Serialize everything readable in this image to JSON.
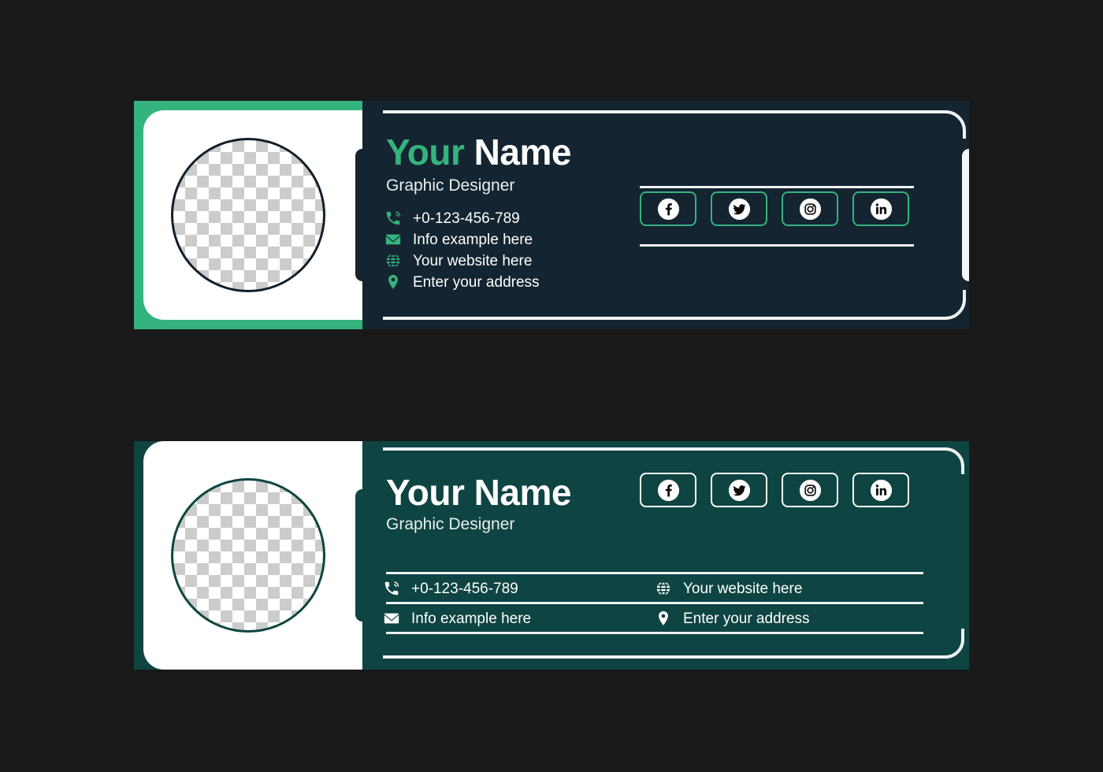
{
  "page": {
    "background_color": "#191919"
  },
  "cards": [
    {
      "id": "card-dark-navy",
      "background_color": "#142430",
      "accent_color": "#35b37e",
      "name_first": "Your",
      "name_last": " Name",
      "role": "Graphic Designer",
      "avatar": "photo-placeholder-checkerboard",
      "contacts": [
        {
          "icon": "phone-icon",
          "text": "+0-123-456-789"
        },
        {
          "icon": "envelope-icon",
          "text": "Info example here"
        },
        {
          "icon": "globe-icon",
          "text": "Your website here"
        },
        {
          "icon": "location-pin-icon",
          "text": "Enter your address"
        }
      ],
      "social": [
        {
          "icon": "facebook-icon",
          "label": "Facebook"
        },
        {
          "icon": "twitter-icon",
          "label": "Twitter"
        },
        {
          "icon": "instagram-icon",
          "label": "Instagram"
        },
        {
          "icon": "linkedin-icon",
          "label": "LinkedIn"
        }
      ]
    },
    {
      "id": "card-teal",
      "background_color": "#0e4441",
      "accent_color": "#ffffff",
      "name_full": "Your Name",
      "role": "Graphic Designer",
      "avatar": "photo-placeholder-checkerboard",
      "contacts_grid": [
        [
          {
            "icon": "phone-icon",
            "text": "+0-123-456-789"
          },
          {
            "icon": "globe-icon",
            "text": "Your website here"
          }
        ],
        [
          {
            "icon": "envelope-icon",
            "text": "Info example here"
          },
          {
            "icon": "location-pin-icon",
            "text": "Enter your address"
          }
        ]
      ],
      "social": [
        {
          "icon": "facebook-icon",
          "label": "Facebook"
        },
        {
          "icon": "twitter-icon",
          "label": "Twitter"
        },
        {
          "icon": "instagram-icon",
          "label": "Instagram"
        },
        {
          "icon": "linkedin-icon",
          "label": "LinkedIn"
        }
      ]
    }
  ]
}
